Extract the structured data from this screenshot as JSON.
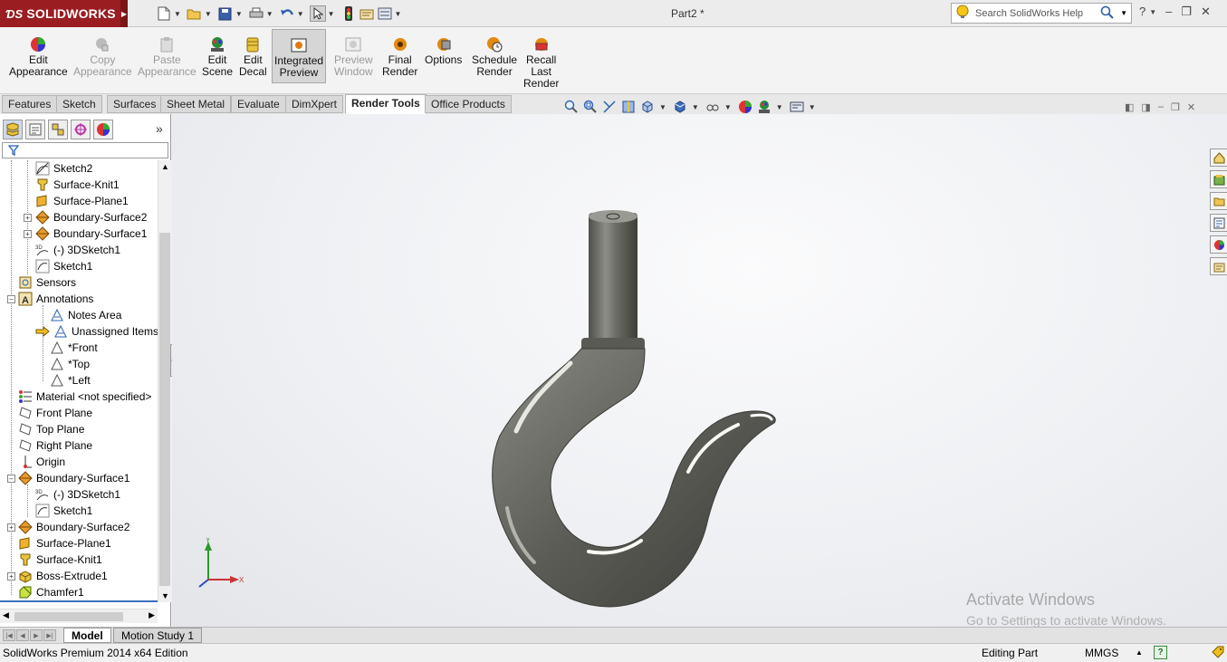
{
  "app": {
    "logo_text": "SOLIDWORKS",
    "document_title": "Part2 *",
    "search_placeholder": "Search SolidWorks Help"
  },
  "ribbon": {
    "buttons": [
      {
        "label": "Edit\nAppearance",
        "line1": "Edit",
        "line2": "Appearance",
        "enabled": true,
        "icon": "appearance-icon"
      },
      {
        "label": "Copy Appearance",
        "line1": "Copy",
        "line2": "Appearance",
        "enabled": false,
        "icon": "copy-appearance-icon"
      },
      {
        "label": "Paste Appearance",
        "line1": "Paste",
        "line2": "Appearance",
        "enabled": false,
        "icon": "paste-appearance-icon"
      },
      {
        "label": "Edit Scene",
        "line1": "Edit",
        "line2": "Scene",
        "enabled": true,
        "icon": "scene-icon"
      },
      {
        "label": "Edit Decal",
        "line1": "Edit",
        "line2": "Decal",
        "enabled": true,
        "icon": "decal-icon"
      },
      {
        "label": "Integrated Preview",
        "line1": "Integrated",
        "line2": "Preview",
        "enabled": true,
        "active": true,
        "icon": "integrated-preview-icon"
      },
      {
        "label": "Preview Window",
        "line1": "Preview",
        "line2": "Window",
        "enabled": false,
        "icon": "preview-window-icon"
      },
      {
        "label": "Final Render",
        "line1": "Final",
        "line2": "Render",
        "enabled": true,
        "icon": "final-render-icon"
      },
      {
        "label": "Options",
        "line1": "Options",
        "line2": "",
        "enabled": true,
        "icon": "options-icon"
      },
      {
        "label": "Schedule Render",
        "line1": "Schedule",
        "line2": "Render",
        "enabled": true,
        "icon": "schedule-render-icon"
      },
      {
        "label": "Recall Last Render",
        "line1": "Recall",
        "line2": "Last",
        "line3": "Render",
        "enabled": true,
        "icon": "recall-render-icon"
      }
    ]
  },
  "tabs": [
    "Features",
    "Sketch",
    "Surfaces",
    "Sheet Metal",
    "Evaluate",
    "DimXpert",
    "Render Tools",
    "Office Products"
  ],
  "active_tab": "Render Tools",
  "tree": {
    "items": [
      {
        "label": "Sketch2",
        "icon": "sketch-icon"
      },
      {
        "label": "Surface-Knit1",
        "icon": "knit-icon"
      },
      {
        "label": "Surface-Plane1",
        "icon": "surface-plane-icon"
      },
      {
        "label": "Boundary-Surface2",
        "icon": "boundary-surface-icon"
      },
      {
        "label": "Boundary-Surface1",
        "icon": "boundary-surface-icon"
      },
      {
        "label": "(-) 3DSketch1",
        "icon": "3dsketch-icon"
      },
      {
        "label": "Sketch1",
        "icon": "sketch-icon"
      },
      {
        "label": "Sensors",
        "icon": "sensors-icon"
      },
      {
        "label": "Annotations",
        "icon": "annotations-icon"
      },
      {
        "label": "Notes Area",
        "icon": "notes-area-icon"
      },
      {
        "label": "Unassigned Items",
        "icon": "unassigned-items-icon"
      },
      {
        "label": "*Front",
        "icon": "annotation-view-icon"
      },
      {
        "label": "*Top",
        "icon": "annotation-view-icon"
      },
      {
        "label": "*Left",
        "icon": "annotation-view-icon"
      },
      {
        "label": "Material <not specified>",
        "icon": "material-icon"
      },
      {
        "label": "Front Plane",
        "icon": "plane-icon"
      },
      {
        "label": "Top Plane",
        "icon": "plane-icon"
      },
      {
        "label": "Right Plane",
        "icon": "plane-icon"
      },
      {
        "label": "Origin",
        "icon": "origin-icon"
      },
      {
        "label": "Boundary-Surface1",
        "icon": "boundary-surface-icon"
      },
      {
        "label": "(-) 3DSketch1",
        "icon": "3dsketch-icon"
      },
      {
        "label": "Sketch1",
        "icon": "sketch-icon"
      },
      {
        "label": "Boundary-Surface2",
        "icon": "boundary-surface-icon"
      },
      {
        "label": "Surface-Plane1",
        "icon": "surface-plane-icon"
      },
      {
        "label": "Surface-Knit1",
        "icon": "knit-icon"
      },
      {
        "label": "Boss-Extrude1",
        "icon": "extrude-icon"
      },
      {
        "label": "Chamfer1",
        "icon": "chamfer-icon"
      }
    ]
  },
  "viewport": {
    "watermark_line1": "Activate Windows",
    "watermark_line2": "Go to Settings to activate Windows.",
    "triad": {
      "x": "X",
      "y": "Y"
    }
  },
  "bottom_tabs": [
    "Model",
    "Motion Study 1"
  ],
  "status": {
    "edition": "SolidWorks Premium 2014 x64 Edition",
    "mode": "Editing Part",
    "units": "MMGS",
    "help": "?"
  },
  "colors": {
    "brand": "#9a1d22",
    "viewport_bg": "#eef0f3",
    "hook_metal": "#6b6b66"
  }
}
